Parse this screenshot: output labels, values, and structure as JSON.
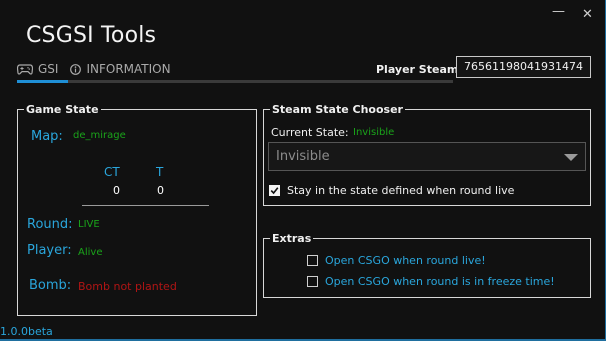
{
  "window": {
    "title": "CSGSI Tools",
    "minimize_glyph": "—",
    "close_glyph": "✕"
  },
  "tabs": [
    {
      "label": "GSI",
      "icon": "gamepad-icon",
      "active": true
    },
    {
      "label": "INFORMATION",
      "icon": "info-icon",
      "active": false
    }
  ],
  "header": {
    "steamid_label": "Player SteamID:",
    "steamid_value": "76561198041931474"
  },
  "game_state": {
    "legend": "Game State",
    "map_label": "Map:",
    "map_value": "de_mirage",
    "ct_label": "CT",
    "t_label": "T",
    "ct_score": "0",
    "t_score": "0",
    "round_label": "Round:",
    "round_value": "LIVE",
    "player_label": "Player:",
    "player_value": "Alive",
    "bomb_label": "Bomb:",
    "bomb_value": "Bomb not planted"
  },
  "steam_state": {
    "legend": "Steam State Chooser",
    "current_label": "Current State:",
    "current_value": "Invisible",
    "dropdown_value": "Invisible",
    "stay_label": "Stay in the state defined when round live",
    "stay_checked": true
  },
  "extras": {
    "legend": "Extras",
    "option1_label": "Open CSGO when round live!",
    "option1_checked": false,
    "option2_label": "Open CSGO when round is in freeze time!",
    "option2_checked": false
  },
  "footer": {
    "version": "1.0.0beta"
  },
  "colors": {
    "accent_blue": "#2aa6dc",
    "status_green": "#1aa31a",
    "status_red": "#b01515",
    "background": "#111111"
  }
}
